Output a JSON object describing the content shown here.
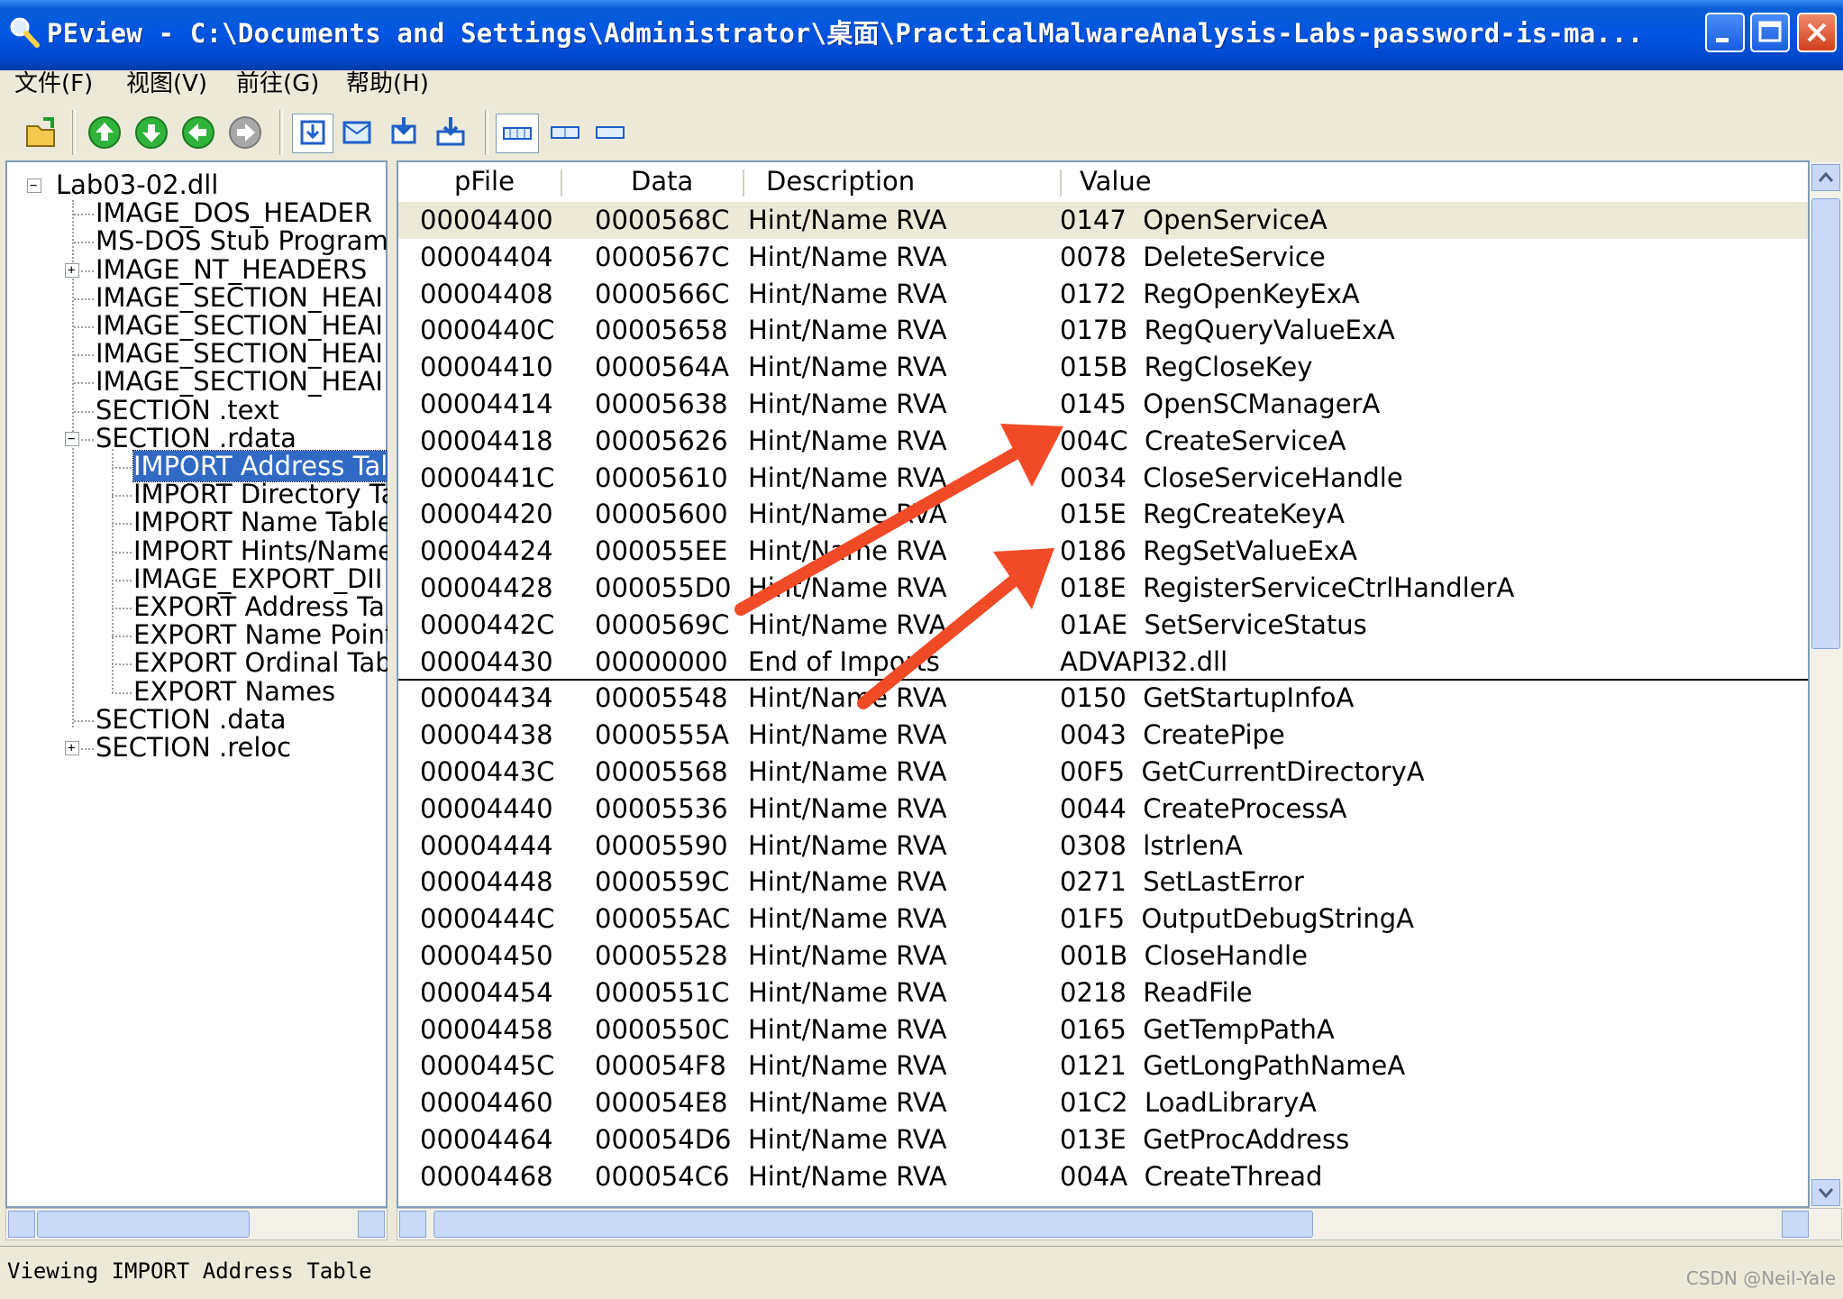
{
  "window": {
    "title": "PEview - C:\\Documents and Settings\\Administrator\\桌面\\PracticalMalwareAnalysis-Labs-password-is-ma..."
  },
  "menu": [
    "文件(F)",
    "视图(V)",
    "前往(G)",
    "帮助(H)"
  ],
  "toolbar": {
    "icons": [
      "open-file-icon",
      "up-arrow-icon",
      "down-arrow-icon",
      "back-arrow-icon",
      "forward-arrow-icon",
      "view-hex-icon",
      "view-details-icon",
      "view-down-icon",
      "view-save-icon",
      "byte-view-icon",
      "word-view-icon",
      "dword-view-icon"
    ]
  },
  "tree": {
    "root": "Lab03-02.dll",
    "items": [
      {
        "label": "IMAGE_DOS_HEADER",
        "level": 1,
        "expander": ""
      },
      {
        "label": "MS-DOS Stub Program",
        "level": 1,
        "expander": ""
      },
      {
        "label": "IMAGE_NT_HEADERS",
        "level": 1,
        "expander": "+"
      },
      {
        "label": "IMAGE_SECTION_HEAI",
        "level": 1,
        "expander": ""
      },
      {
        "label": "IMAGE_SECTION_HEAI",
        "level": 1,
        "expander": ""
      },
      {
        "label": "IMAGE_SECTION_HEAI",
        "level": 1,
        "expander": ""
      },
      {
        "label": "IMAGE_SECTION_HEAI",
        "level": 1,
        "expander": ""
      },
      {
        "label": "SECTION .text",
        "level": 1,
        "expander": ""
      },
      {
        "label": "SECTION .rdata",
        "level": 1,
        "expander": "-"
      },
      {
        "label": "IMPORT Address Tal",
        "level": 2,
        "expander": "",
        "selected": true
      },
      {
        "label": "IMPORT Directory Ta",
        "level": 2,
        "expander": ""
      },
      {
        "label": "IMPORT Name Table",
        "level": 2,
        "expander": ""
      },
      {
        "label": "IMPORT Hints/Name",
        "level": 2,
        "expander": ""
      },
      {
        "label": "IMAGE_EXPORT_DII",
        "level": 2,
        "expander": ""
      },
      {
        "label": "EXPORT Address Ta",
        "level": 2,
        "expander": ""
      },
      {
        "label": "EXPORT Name Point",
        "level": 2,
        "expander": ""
      },
      {
        "label": "EXPORT Ordinal Tab",
        "level": 2,
        "expander": ""
      },
      {
        "label": "EXPORT Names",
        "level": 2,
        "expander": ""
      },
      {
        "label": "SECTION .data",
        "level": 1,
        "expander": ""
      },
      {
        "label": "SECTION .reloc",
        "level": 1,
        "expander": "+"
      }
    ]
  },
  "table": {
    "columns": [
      "pFile",
      "Data",
      "Description",
      "Value"
    ],
    "rows": [
      [
        "00004400",
        "0000568C",
        "Hint/Name RVA",
        "0147  OpenServiceA"
      ],
      [
        "00004404",
        "0000567C",
        "Hint/Name RVA",
        "0078  DeleteService"
      ],
      [
        "00004408",
        "0000566C",
        "Hint/Name RVA",
        "0172  RegOpenKeyExA"
      ],
      [
        "0000440C",
        "00005658",
        "Hint/Name RVA",
        "017B  RegQueryValueExA"
      ],
      [
        "00004410",
        "0000564A",
        "Hint/Name RVA",
        "015B  RegCloseKey"
      ],
      [
        "00004414",
        "00005638",
        "Hint/Name RVA",
        "0145  OpenSCManagerA"
      ],
      [
        "00004418",
        "00005626",
        "Hint/Name RVA",
        "004C  CreateServiceA"
      ],
      [
        "0000441C",
        "00005610",
        "Hint/Name RVA",
        "0034  CloseServiceHandle"
      ],
      [
        "00004420",
        "00005600",
        "Hint/Name RVA",
        "015E  RegCreateKeyA"
      ],
      [
        "00004424",
        "000055EE",
        "Hint/Name RVA",
        "0186  RegSetValueExA"
      ],
      [
        "00004428",
        "000055D0",
        "Hint/Name RVA",
        "018E  RegisterServiceCtrlHandlerA"
      ],
      [
        "0000442C",
        "0000569C",
        "Hint/Name RVA",
        "01AE  SetServiceStatus"
      ],
      [
        "00004430",
        "00000000",
        "End of Imports",
        "ADVAPI32.dll"
      ],
      [
        "00004434",
        "00005548",
        "Hint/Name RVA",
        "0150  GetStartupInfoA"
      ],
      [
        "00004438",
        "0000555A",
        "Hint/Name RVA",
        "0043  CreatePipe"
      ],
      [
        "0000443C",
        "00005568",
        "Hint/Name RVA",
        "00F5  GetCurrentDirectoryA"
      ],
      [
        "00004440",
        "00005536",
        "Hint/Name RVA",
        "0044  CreateProcessA"
      ],
      [
        "00004444",
        "00005590",
        "Hint/Name RVA",
        "0308  lstrlenA"
      ],
      [
        "00004448",
        "0000559C",
        "Hint/Name RVA",
        "0271  SetLastError"
      ],
      [
        "0000444C",
        "000055AC",
        "Hint/Name RVA",
        "01F5  OutputDebugStringA"
      ],
      [
        "00004450",
        "00005528",
        "Hint/Name RVA",
        "001B  CloseHandle"
      ],
      [
        "00004454",
        "0000551C",
        "Hint/Name RVA",
        "0218  ReadFile"
      ],
      [
        "00004458",
        "0000550C",
        "Hint/Name RVA",
        "0165  GetTempPathA"
      ],
      [
        "0000445C",
        "000054F8",
        "Hint/Name RVA",
        "0121  GetLongPathNameA"
      ],
      [
        "00004460",
        "000054E8",
        "Hint/Name RVA",
        "01C2  LoadLibraryA"
      ],
      [
        "00004464",
        "000054D6",
        "Hint/Name RVA",
        "013E  GetProcAddress"
      ],
      [
        "00004468",
        "000054C6",
        "Hint/Name RVA",
        "004A  CreateThread"
      ]
    ],
    "selected_row": 0,
    "separator_after_row": 12
  },
  "annotations": {
    "arrow_color": "#f04a26"
  },
  "status": {
    "text": "Viewing IMPORT Address Table"
  },
  "watermark": "CSDN @Neil-Yale"
}
